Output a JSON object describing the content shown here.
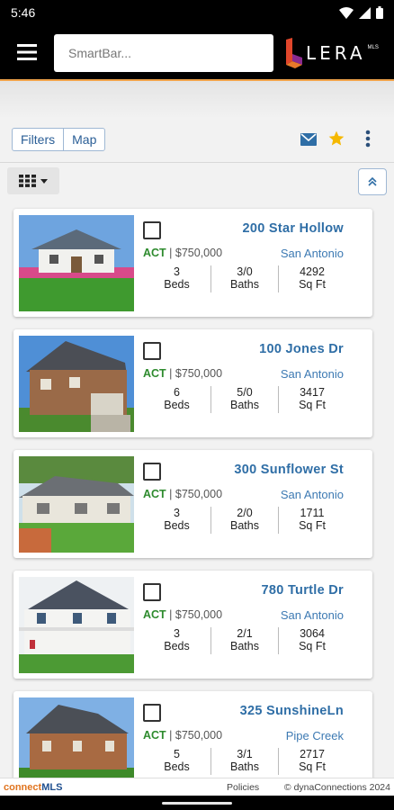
{
  "status_bar": {
    "time": "5:46"
  },
  "search": {
    "placeholder": "SmartBar..."
  },
  "logo": {
    "text": "LERA",
    "sub": "MLS"
  },
  "toolbar": {
    "filters_label": "Filters",
    "map_label": "Map"
  },
  "colors": {
    "accent": "#2f6ea6",
    "status_active": "#2e8b2e",
    "brand_orange": "#e0741f",
    "brand_blue": "#1f4f8f",
    "star": "#f5b800"
  },
  "listings": [
    {
      "address": "200 Star Hollow",
      "status": "ACT",
      "price": "$750,000",
      "city": "San Antonio",
      "beds": "3",
      "beds_label": "Beds",
      "baths": "3/0",
      "baths_label": "Baths",
      "sqft": "4292",
      "sqft_label": "Sq Ft"
    },
    {
      "address": "100 Jones Dr",
      "status": "ACT",
      "price": "$750,000",
      "city": "San Antonio",
      "beds": "6",
      "beds_label": "Beds",
      "baths": "5/0",
      "baths_label": "Baths",
      "sqft": "3417",
      "sqft_label": "Sq Ft"
    },
    {
      "address": "300 Sunflower St",
      "status": "ACT",
      "price": "$750,000",
      "city": "San Antonio",
      "beds": "3",
      "beds_label": "Beds",
      "baths": "2/0",
      "baths_label": "Baths",
      "sqft": "1711",
      "sqft_label": "Sq Ft"
    },
    {
      "address": "780 Turtle Dr",
      "status": "ACT",
      "price": "$750,000",
      "city": "San Antonio",
      "beds": "3",
      "beds_label": "Beds",
      "baths": "2/1",
      "baths_label": "Baths",
      "sqft": "3064",
      "sqft_label": "Sq Ft"
    },
    {
      "address": "325 SunshineLn",
      "status": "ACT",
      "price": "$750,000",
      "city": "Pipe Creek",
      "beds": "5",
      "beds_label": "Beds",
      "baths": "3/1",
      "baths_label": "Baths",
      "sqft": "2717",
      "sqft_label": "Sq Ft"
    }
  ],
  "footer": {
    "brand_part1": "connect",
    "brand_part2": "MLS",
    "policies": "Policies",
    "copyright": "© dynaConnections 2024"
  }
}
